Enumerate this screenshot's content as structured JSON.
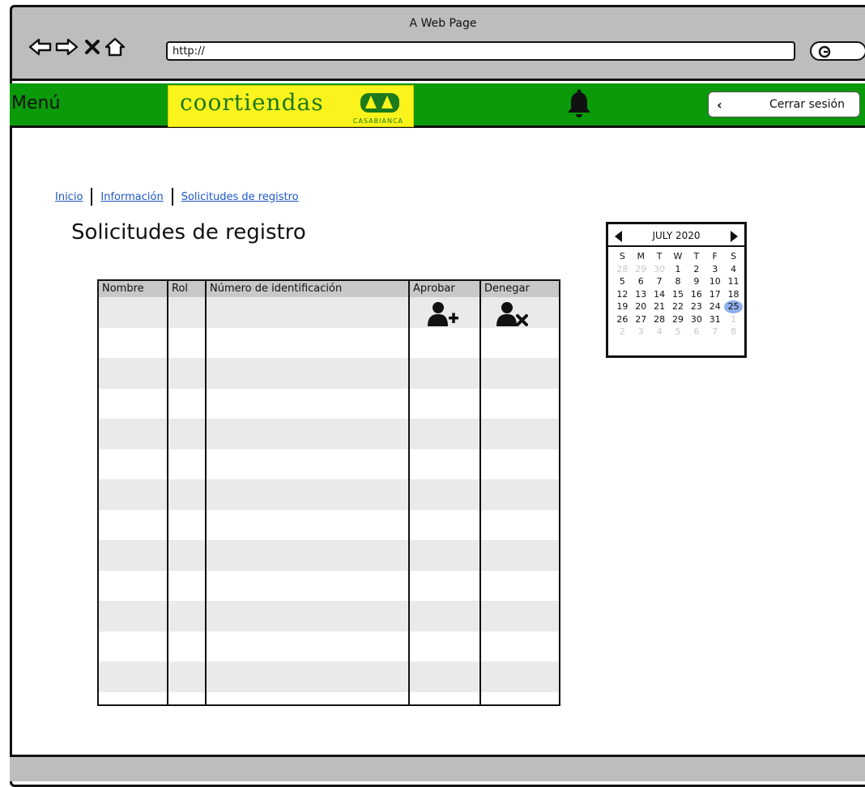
{
  "browser": {
    "title": "A Web Page",
    "url": "http://"
  },
  "header": {
    "menu_label": "Menú",
    "logo_text": "coortiendas",
    "logo_sub": "CASABIANCA",
    "logout_label": "Cerrar sesión"
  },
  "breadcrumb": [
    "Inicio",
    "Información",
    "Solicitudes de registro"
  ],
  "page_title": "Solicitudes de registro",
  "table": {
    "columns": [
      "Nombre",
      "Rol",
      "Número de identificación",
      "Aprobar",
      "Denegar"
    ],
    "row_count": 13
  },
  "calendar": {
    "month_label": "JULY 2020",
    "weekdays": [
      "S",
      "M",
      "T",
      "W",
      "T",
      "F",
      "S"
    ],
    "days": [
      [
        "28",
        "29",
        "30",
        "1",
        "2",
        "3",
        "4"
      ],
      [
        "5",
        "6",
        "7",
        "8",
        "9",
        "10",
        "11"
      ],
      [
        "12",
        "13",
        "14",
        "15",
        "16",
        "17",
        "18"
      ],
      [
        "19",
        "20",
        "21",
        "22",
        "23",
        "24",
        "25"
      ],
      [
        "26",
        "27",
        "28",
        "29",
        "30",
        "31",
        "1"
      ],
      [
        "2",
        "3",
        "4",
        "5",
        "6",
        "7",
        "8"
      ]
    ],
    "selected_day": "25"
  },
  "colors": {
    "header_green": "#0a9a0a",
    "logo_yellow": "#fbf31c",
    "link_blue": "#1c57c9",
    "selection_blue": "#8fb0ec"
  }
}
